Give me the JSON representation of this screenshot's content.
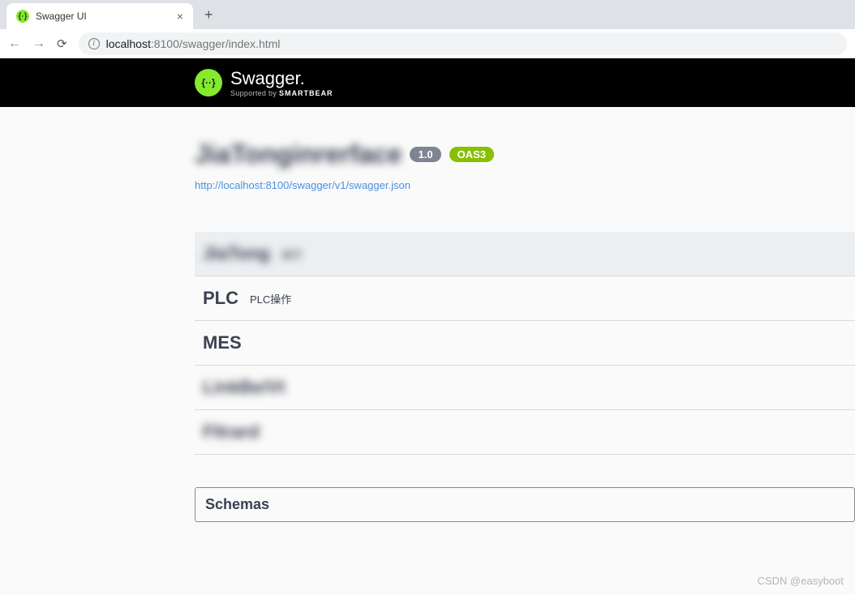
{
  "browser": {
    "tab_title": "Swagger UI",
    "url_host": "localhost",
    "url_port": ":8100",
    "url_path": "/swagger/index.html"
  },
  "header": {
    "brand": "Swagger",
    "brand_suffix": ".",
    "supported_prefix": "Supported by ",
    "supported_by": "SMARTBEAR",
    "logo_glyph": "{··}"
  },
  "api": {
    "title": "JiaTonginrerface",
    "version": "1.0",
    "oas_badge": "OAS3",
    "spec_url": "http://localhost:8100/swagger/v1/swagger.json"
  },
  "tags": [
    {
      "name": "JiaTong",
      "desc": "操作",
      "blurred": true,
      "highlighted": true
    },
    {
      "name": "PLC",
      "desc": "PLC操作",
      "blurred": false,
      "highlighted": false
    },
    {
      "name": "MES",
      "desc": "",
      "blurred": false,
      "highlighted": false
    },
    {
      "name": "LinkBe/Vt",
      "desc": "",
      "blurred": true,
      "highlighted": false
    },
    {
      "name": "Fltrard",
      "desc": "",
      "blurred": true,
      "highlighted": false
    }
  ],
  "schemas_label": "Schemas",
  "watermark": "CSDN @easyboot"
}
